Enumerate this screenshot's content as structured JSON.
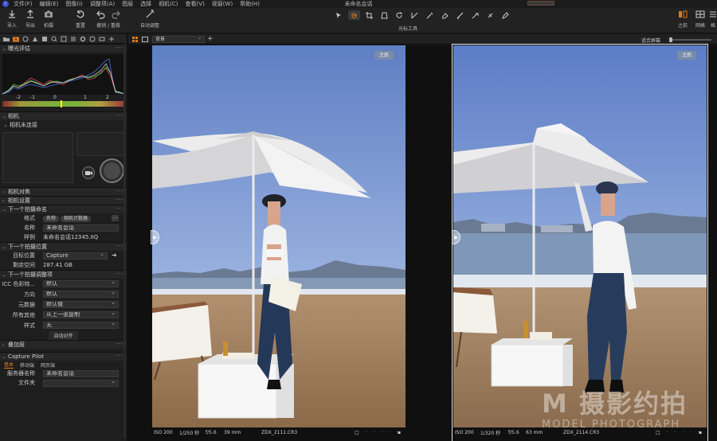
{
  "menubar": {
    "items": [
      "文件(F)",
      "编辑(E)",
      "图像(I)",
      "调整项(A)",
      "图层",
      "选择",
      "相机(C)",
      "查看(V)",
      "视窗(W)",
      "帮助(H)"
    ],
    "title": "未命名会话"
  },
  "toolbar": {
    "import": "导入",
    "export": "导出",
    "shoot": "拍摄",
    "reset": "重置",
    "undo_redo": "撤销 / 重做",
    "auto_adjust": "自动调整",
    "cursor_tools_label": "光标工具",
    "before_after": "之前",
    "grid": "网格",
    "more": "格"
  },
  "panel": {
    "exposure": {
      "title": "曝光评估",
      "scale": [
        "-2",
        "-1",
        "0",
        "1",
        "2"
      ]
    },
    "camera": {
      "title": "相机",
      "status": "相机未连接"
    },
    "camera_focus": {
      "title": "相机对焦"
    },
    "camera_settings": {
      "title": "相机设置"
    },
    "next_capture_name": {
      "title": "下一个拍摄命名",
      "format_label": "格式",
      "format_tokens": [
        "名称",
        "相机计数器"
      ],
      "name_label": "名称",
      "name_value": "未命名会话",
      "sample_label": "样例",
      "sample_value": "未命名会话12345.IIQ"
    },
    "next_capture_location": {
      "title": "下一个拍摄位置",
      "dest_label": "目标位置",
      "dest_value": "Capture",
      "free_label": "剩余空间",
      "free_value": "287.41 GB"
    },
    "next_capture_adjust": {
      "title": "下一个拍摄调整项",
      "icc_label": "ICC 色彩特...",
      "icc_value": "默认",
      "orient_label": "方向",
      "orient_value": "默认",
      "meta_label": "元数据",
      "meta_value": "默认值",
      "other_label": "所有其他",
      "other_value": "从上一张复制",
      "style_label": "样式",
      "style_value": "无",
      "auto_align": "自动对齐"
    },
    "overlay": {
      "title": "叠加层"
    },
    "capture_pilot": {
      "title": "Capture Pilot",
      "tabs": [
        "基本",
        "移动端",
        "网页端"
      ],
      "server_label": "服务器名称",
      "server_value": "未命名会话",
      "folder_label": "文件夹",
      "folder_value": ""
    }
  },
  "viewer_bar": {
    "select_value": "背景",
    "fit_label": "适合屏幕"
  },
  "viewer": {
    "left": {
      "badge": "之后",
      "iso": "ISO 200",
      "shutter": "1/250 秒",
      "aperture": "f/5.6",
      "focal": "39 mm",
      "file": "ZDX_2111.CR3"
    },
    "right": {
      "badge": "之后",
      "iso": "ISO 200",
      "shutter": "1/320 秒",
      "aperture": "f/5.6",
      "focal": "63 mm",
      "file": "ZDX_2114.CR3"
    }
  },
  "watermark": {
    "big": "M 摄影约拍",
    "small": "MODEL PHOTOGRAPH"
  },
  "colors": {
    "accent": "#e07a1a",
    "panel_bg": "#1e1e1e",
    "badge": "#7a8ba8"
  }
}
